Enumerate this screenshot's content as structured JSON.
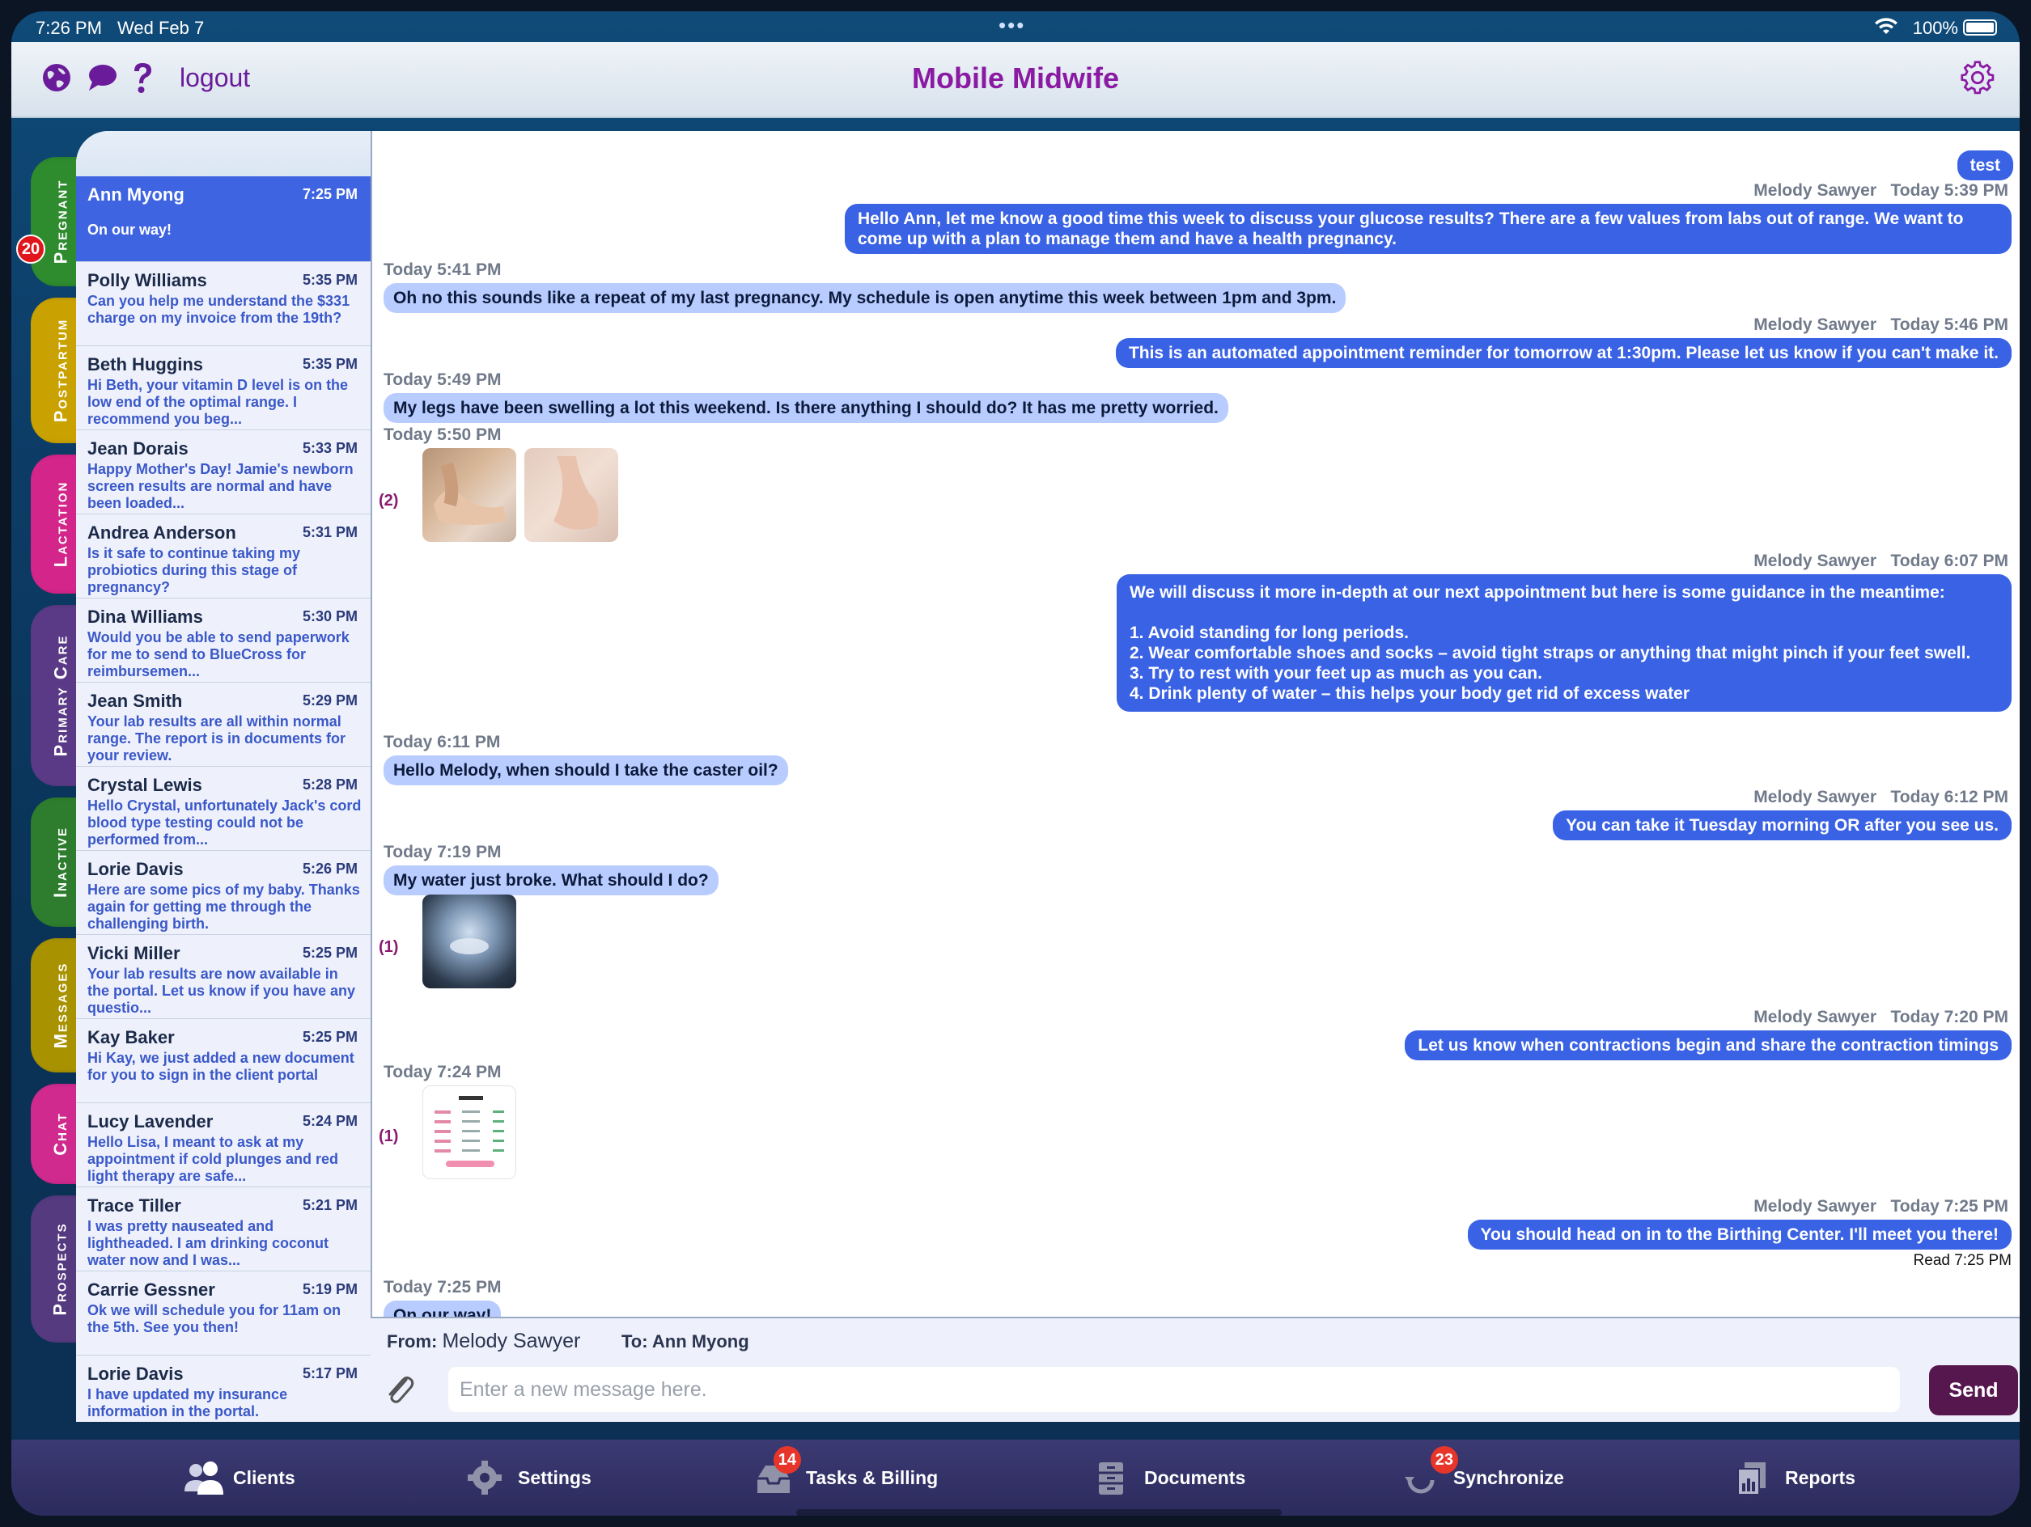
{
  "status_bar": {
    "time": "7:26 PM",
    "date": "Wed Feb 7",
    "battery": "100%"
  },
  "header": {
    "title": "Mobile Midwife",
    "logout_label": "logout",
    "icons": [
      "globe-icon",
      "chat-bubble-icon",
      "question-icon",
      "gear-icon"
    ]
  },
  "side_tabs": [
    {
      "label": "Pregnant",
      "color": "#2e8b2e",
      "badge": "20"
    },
    {
      "label": "Postpartum",
      "color": "#c9a100"
    },
    {
      "label": "Lactation",
      "color": "#d3258a"
    },
    {
      "label": "Primary Care",
      "color": "#5a3a86"
    },
    {
      "label": "Inactive",
      "color": "#2e7d2e"
    },
    {
      "label": "Messages",
      "color": "#a89200"
    },
    {
      "label": "Chat",
      "color": "#d02a8e"
    },
    {
      "label": "Prospects",
      "color": "#553a80"
    }
  ],
  "clients": [
    {
      "name": "Ann Myong",
      "time": "7:25 PM",
      "preview": "On our way!",
      "selected": true
    },
    {
      "name": "Polly Williams",
      "time": "5:35 PM",
      "preview": "Can you help me understand the $331 charge on my invoice from the 19th?"
    },
    {
      "name": "Beth Huggins",
      "time": "5:35 PM",
      "preview": "Hi Beth, your vitamin D level is on the low end of the optimal range.  I recommend you beg..."
    },
    {
      "name": "Jean Dorais",
      "time": "5:33 PM",
      "preview": "Happy Mother's Day!  Jamie's newborn screen results are normal and have been loaded..."
    },
    {
      "name": "Andrea Anderson",
      "time": "5:31 PM",
      "preview": "Is it safe to continue taking my probiotics during this stage of pregnancy?"
    },
    {
      "name": "Dina Williams",
      "time": "5:30 PM",
      "preview": "Would you be able to send paperwork for me to send to BlueCross for reimbursemen..."
    },
    {
      "name": "Jean Smith",
      "time": "5:29 PM",
      "preview": "Your lab results are all within normal range.  The report is in documents for your review."
    },
    {
      "name": "Crystal Lewis",
      "time": "5:28 PM",
      "preview": "Hello Crystal, unfortunately Jack's cord blood type testing could not be performed from..."
    },
    {
      "name": "Lorie Davis",
      "time": "5:26 PM",
      "preview": "Here are some pics of my baby.  Thanks again for getting me through the challenging birth."
    },
    {
      "name": "Vicki Miller",
      "time": "5:25 PM",
      "preview": "Your lab results are now available in the portal.  Let us know if you have any questio..."
    },
    {
      "name": "Kay Baker",
      "time": "5:25 PM",
      "preview": "Hi Kay, we just added a new document for you to sign in the client portal"
    },
    {
      "name": "Lucy Lavender",
      "time": "5:24 PM",
      "preview": "Hello Lisa, I meant to ask at my appointment if cold plunges and red light therapy are safe..."
    },
    {
      "name": "Trace Tiller",
      "time": "5:21 PM",
      "preview": "I was pretty nauseated and lightheaded.  I am drinking coconut water now and I was..."
    },
    {
      "name": "Carrie Gessner",
      "time": "5:19 PM",
      "preview": "Ok we will schedule you for 11am on the 5th.  See you then!"
    },
    {
      "name": "Lorie Davis",
      "time": "5:17 PM",
      "preview": "I have updated my insurance information in the portal."
    }
  ],
  "chat": {
    "m0": {
      "text": "test"
    },
    "m1": {
      "sender": "Melody Sawyer",
      "time": "Today 5:39 PM",
      "text": "Hello Ann, let me know a good time this week to discuss your glucose results?  There are a few values from labs out of range.  We want to come up with a plan to manage them and have a health pregnancy."
    },
    "m2": {
      "time": "Today 5:41 PM",
      "text": "Oh no this sounds like a repeat of my last pregnancy. My schedule is open anytime this week between 1pm and 3pm."
    },
    "m3": {
      "sender": "Melody Sawyer",
      "time": "Today 5:46 PM",
      "text": "This is an automated appointment reminder for tomorrow at 1:30pm.  Please let us know if you can't make it."
    },
    "m4": {
      "time": "Today 5:49 PM",
      "text": "My legs have been swelling a lot this weekend.  Is there anything I should do? It has me pretty worried."
    },
    "m5": {
      "time": "Today 5:50 PM",
      "count": "(2)"
    },
    "m6": {
      "sender": "Melody Sawyer",
      "time": "Today 6:07 PM",
      "intro": "We will discuss it more in-depth at our next appointment but here is some guidance in the meantime:",
      "items": [
        "1. Avoid standing for long periods.",
        "2. Wear comfortable shoes and socks – avoid tight straps or anything that might pinch if your feet swell.",
        "3. Try to rest with your feet up as much as you can.",
        "4. Drink plenty of water – this helps your body get rid of excess water"
      ]
    },
    "m7": {
      "time": "Today 6:11 PM",
      "text": "Hello Melody, when should I take the caster oil?"
    },
    "m8": {
      "sender": "Melody Sawyer",
      "time": "Today 6:12 PM",
      "text": "You can take it Tuesday morning OR after you see us."
    },
    "m9": {
      "time": "Today 7:19 PM",
      "text": "My water just broke. What should I do?",
      "count": "(1)"
    },
    "m10": {
      "sender": "Melody Sawyer",
      "time": "Today 7:20 PM",
      "text": "Let us know when contractions begin and share the contraction timings"
    },
    "m11": {
      "time": "Today 7:24 PM",
      "count": "(1)"
    },
    "m12": {
      "sender": "Melody Sawyer",
      "time": "Today 7:25 PM",
      "text": "You should head on in to the Birthing Center.  I'll meet you there!",
      "read": "Read 7:25 PM"
    },
    "m13": {
      "time": "Today 7:25 PM",
      "text": "On our way!"
    }
  },
  "composer": {
    "from_label": "From:",
    "from_value": "Melody Sawyer",
    "to_label": "To:",
    "to_value": "Ann Myong",
    "placeholder": "Enter a new message here.",
    "send_label": "Send"
  },
  "tabbar": [
    {
      "label": "Clients",
      "icon": "people-icon"
    },
    {
      "label": "Settings",
      "icon": "gear-icon"
    },
    {
      "label": "Tasks & Billing",
      "icon": "inbox-icon",
      "badge": "14"
    },
    {
      "label": "Documents",
      "icon": "cabinet-icon"
    },
    {
      "label": "Synchronize",
      "icon": "sync-icon",
      "badge": "23"
    },
    {
      "label": "Reports",
      "icon": "reports-icon"
    }
  ]
}
